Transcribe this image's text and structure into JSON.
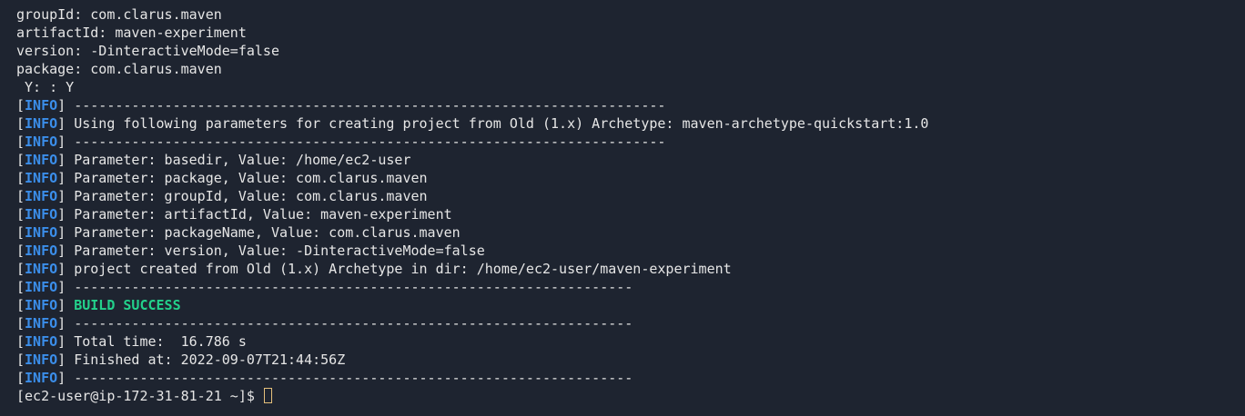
{
  "terminal": {
    "pre_lines": [
      "groupId: com.clarus.maven",
      "artifactId: maven-experiment",
      "version: -DinteractiveMode=false",
      "package: com.clarus.maven",
      " Y: : Y"
    ],
    "info_tag": "INFO",
    "info_lines": [
      "------------------------------------------------------------------------",
      "Using following parameters for creating project from Old (1.x) Archetype: maven-archetype-quickstart:1.0",
      "------------------------------------------------------------------------",
      "Parameter: basedir, Value: /home/ec2-user",
      "Parameter: package, Value: com.clarus.maven",
      "Parameter: groupId, Value: com.clarus.maven",
      "Parameter: artifactId, Value: maven-experiment",
      "Parameter: packageName, Value: com.clarus.maven",
      "Parameter: version, Value: -DinteractiveMode=false",
      "project created from Old (1.x) Archetype in dir: /home/ec2-user/maven-experiment",
      "--------------------------------------------------------------------",
      "BUILD SUCCESS",
      "--------------------------------------------------------------------",
      "Total time:  16.786 s",
      "Finished at: 2022-09-07T21:44:56Z",
      "--------------------------------------------------------------------"
    ],
    "success_index": 11,
    "prompt": "[ec2-user@ip-172-31-81-21 ~]$ "
  },
  "colors": {
    "background": "#1e2430",
    "info": "#3b8eea",
    "success": "#23d18b",
    "cursor": "#e5c07b"
  }
}
